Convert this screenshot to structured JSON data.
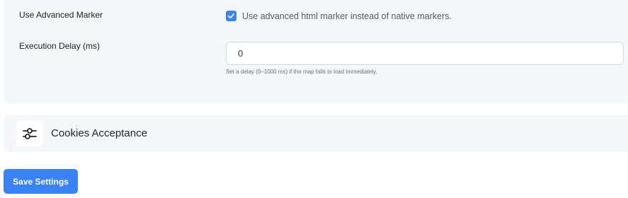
{
  "settings": {
    "advanced_marker": {
      "label": "Use Advanced Marker",
      "checked": true,
      "checkbox_text": "Use advanced html marker instead of native markers."
    },
    "execution_delay": {
      "label": "Execution Delay (ms)",
      "value": "0",
      "help": "Set a delay (0–1000 ms) if the map fails to load immediately."
    }
  },
  "accordion": {
    "title": "Cookies Acceptance",
    "icon": "sliders-icon"
  },
  "footer": {
    "save_label": "Save Settings"
  },
  "colors": {
    "accent": "#3b82f6",
    "panel_bg": "#f6f7fa"
  }
}
